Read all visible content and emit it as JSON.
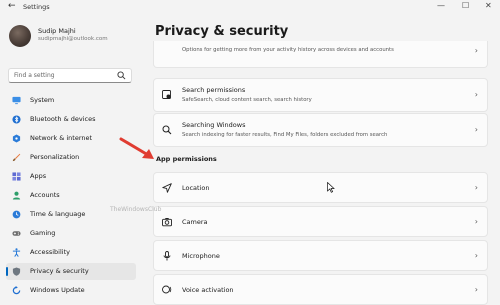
{
  "window": {
    "title": "Settings",
    "back_glyph": "←",
    "minimize_glyph": "—",
    "maximize_glyph": "☐",
    "close_glyph": "✕"
  },
  "user": {
    "name": "Sudip Majhi",
    "email": "sudipmajhi@outlook.com"
  },
  "search": {
    "placeholder": "Find a setting"
  },
  "nav": [
    {
      "label": "System",
      "icon": "monitor-icon"
    },
    {
      "label": "Bluetooth & devices",
      "icon": "bluetooth-icon"
    },
    {
      "label": "Network & internet",
      "icon": "network-icon"
    },
    {
      "label": "Personalization",
      "icon": "brush-icon"
    },
    {
      "label": "Apps",
      "icon": "apps-icon"
    },
    {
      "label": "Accounts",
      "icon": "accounts-icon"
    },
    {
      "label": "Time & language",
      "icon": "globe-clock-icon"
    },
    {
      "label": "Gaming",
      "icon": "gamepad-icon"
    },
    {
      "label": "Accessibility",
      "icon": "accessibility-icon"
    },
    {
      "label": "Privacy & security",
      "icon": "shield-icon",
      "active": true
    },
    {
      "label": "Windows Update",
      "icon": "update-icon"
    }
  ],
  "page": {
    "title": "Privacy & security"
  },
  "cards_top": [
    {
      "subtitle": "Options for getting more from your activity history across devices and accounts"
    },
    {
      "title": "Search permissions",
      "subtitle": "SafeSearch, cloud content search, search history",
      "icon": "search-permissions-icon"
    },
    {
      "title": "Searching Windows",
      "subtitle": "Search indexing for faster results, Find My Files, folders excluded from search",
      "icon": "magnifier-icon"
    }
  ],
  "section": {
    "title": "App permissions"
  },
  "app_permissions": [
    {
      "title": "Location",
      "icon": "location-icon"
    },
    {
      "title": "Camera",
      "icon": "camera-icon"
    },
    {
      "title": "Microphone",
      "icon": "microphone-icon"
    },
    {
      "title": "Voice activation",
      "icon": "voice-icon"
    }
  ],
  "chevron": "›",
  "watermark": "TheWindowsClub",
  "colors": {
    "accent": "#0067c0",
    "annotation_arrow": "#e03c31"
  }
}
